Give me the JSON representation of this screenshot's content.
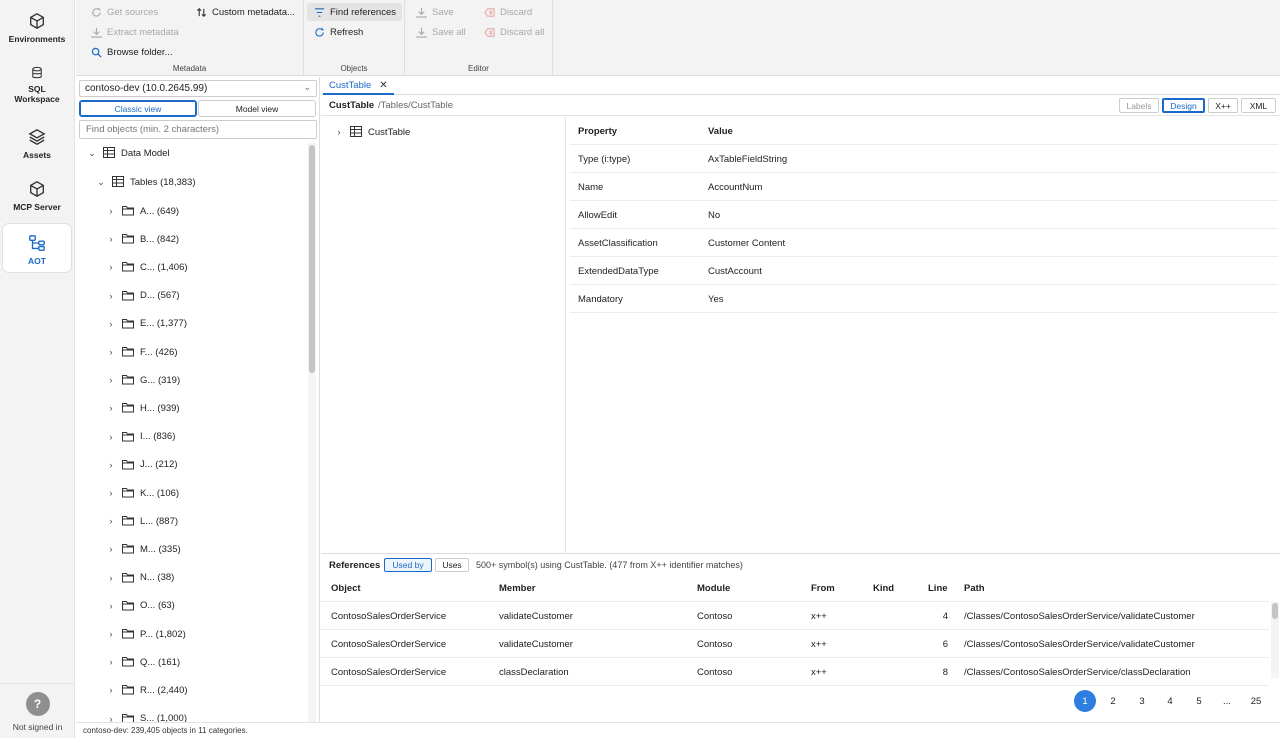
{
  "nav": {
    "items": [
      {
        "label": "Environments",
        "icon": "cube-icon"
      },
      {
        "label": "SQL Workspace",
        "icon": "database-icon"
      },
      {
        "label": "Assets",
        "icon": "layers-icon"
      },
      {
        "label": "MCP Server",
        "icon": "cube-icon"
      },
      {
        "label": "AOT",
        "icon": "tree-icon"
      }
    ],
    "active": "AOT",
    "help": "?",
    "signed_in": "Not signed in"
  },
  "ribbon": {
    "metadata": {
      "title": "Metadata",
      "get_sources": "Get sources",
      "extract_metadata": "Extract metadata",
      "browse_folder": "Browse folder...",
      "custom_metadata": "Custom metadata..."
    },
    "objects": {
      "title": "Objects",
      "find_references": "Find references",
      "refresh": "Refresh"
    },
    "editor": {
      "title": "Editor",
      "save": "Save",
      "save_all": "Save all",
      "discard": "Discard",
      "discard_all": "Discard all"
    }
  },
  "explorer": {
    "environment": "contoso-dev (10.0.2645.99)",
    "classic_view": "Classic view",
    "model_view": "Model view",
    "search_placeholder": "Find objects (min. 2 characters)",
    "root": "Data Model",
    "tables": "Tables (18,383)",
    "folders": [
      "A... (649)",
      "B... (842)",
      "C... (1,406)",
      "D... (567)",
      "E... (1,377)",
      "F... (426)",
      "G... (319)",
      "H... (939)",
      "I... (836)",
      "J... (212)",
      "K... (106)",
      "L... (887)",
      "M... (335)",
      "N... (38)",
      "O... (63)",
      "P... (1,802)",
      "Q... (161)",
      "R... (2,440)",
      "S... (1,000)"
    ]
  },
  "status": "contoso-dev: 239,405 objects in 11 categories.",
  "tab": {
    "label": "CustTable",
    "close": "✕"
  },
  "pathbar": {
    "name": "CustTable",
    "path": "/Tables/CustTable",
    "labels": "Labels",
    "design": "Design",
    "xpp": "X++",
    "xml": "XML"
  },
  "design_tree": {
    "node": "CustTable"
  },
  "properties": {
    "headers": {
      "property": "Property",
      "value": "Value"
    },
    "rows": [
      {
        "property": "Type (i:type)",
        "value": "AxTableFieldString"
      },
      {
        "property": "Name",
        "value": "AccountNum"
      },
      {
        "property": "AllowEdit",
        "value": "No"
      },
      {
        "property": "AssetClassification",
        "value": "Customer Content"
      },
      {
        "property": "ExtendedDataType",
        "value": "CustAccount"
      },
      {
        "property": "Mandatory",
        "value": "Yes"
      }
    ]
  },
  "references": {
    "title": "References",
    "used_by": "Used by",
    "uses": "Uses",
    "summary": "500+ symbol(s) using CustTable. (477 from X++ identifier matches)",
    "headers": {
      "object": "Object",
      "member": "Member",
      "module": "Module",
      "from": "From",
      "kind": "Kind",
      "line": "Line",
      "path": "Path"
    },
    "rows": [
      {
        "object": "ContosoSalesOrderService",
        "member": "validateCustomer",
        "module": "Contoso",
        "from": "x++",
        "kind": "",
        "line": "4",
        "path": "/Classes/ContosoSalesOrderService/validateCustomer"
      },
      {
        "object": "ContosoSalesOrderService",
        "member": "validateCustomer",
        "module": "Contoso",
        "from": "x++",
        "kind": "",
        "line": "6",
        "path": "/Classes/ContosoSalesOrderService/validateCustomer"
      },
      {
        "object": "ContosoSalesOrderService",
        "member": "classDeclaration",
        "module": "Contoso",
        "from": "x++",
        "kind": "",
        "line": "8",
        "path": "/Classes/ContosoSalesOrderService/classDeclaration"
      }
    ],
    "pages": [
      "1",
      "2",
      "3",
      "4",
      "5",
      "...",
      "25"
    ],
    "current_page": "1"
  },
  "colors": {
    "accent": "#1b6ac9",
    "page_active": "#2f7de1",
    "rail_bg": "#f3f3f3"
  }
}
